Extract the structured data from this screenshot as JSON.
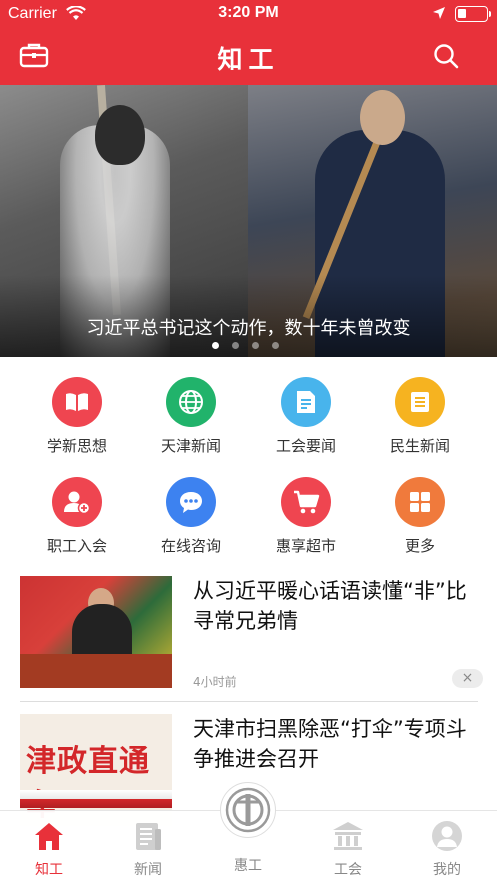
{
  "status_bar": {
    "carrier": "Carrier",
    "time": "3:20 PM",
    "battery": 0.2
  },
  "nav": {
    "title": "知工",
    "left_icon": "briefcase-icon",
    "right_icon": "search-icon"
  },
  "banner": {
    "caption": "习近平总书记这个动作，数十年未曾改变",
    "page_count": 4,
    "active_page": 1
  },
  "menu": {
    "items": [
      {
        "label": "学新思想",
        "icon": "book-icon",
        "color": "#ef4550"
      },
      {
        "label": "天津新闻",
        "icon": "globe-icon",
        "color": "#21b36b"
      },
      {
        "label": "工会要闻",
        "icon": "document-icon",
        "color": "#48b4ec"
      },
      {
        "label": "民生新闻",
        "icon": "list-icon",
        "color": "#f6b320"
      },
      {
        "label": "职工入会",
        "icon": "user-add-icon",
        "color": "#ef4550"
      },
      {
        "label": "在线咨询",
        "icon": "chat-icon",
        "color": "#3d82f0"
      },
      {
        "label": "惠享超市",
        "icon": "cart-icon",
        "color": "#ef4550"
      },
      {
        "label": "更多",
        "icon": "grid-icon",
        "color": "#f07a3c"
      }
    ]
  },
  "news": [
    {
      "title": "从习近平暖心话语读懂“非”比寻常兄弟情",
      "time": "4小时前",
      "close": "×"
    },
    {
      "title": "天津市扫黑除恶“打伞”专项斗争推进会召开",
      "thumb_text": "津政直通车"
    }
  ],
  "tabbar": {
    "active_color": "#e8313a",
    "tabs": [
      {
        "label": "知工",
        "icon": "home-icon",
        "active": true
      },
      {
        "label": "新闻",
        "icon": "news-icon",
        "active": false
      },
      {
        "label": "惠工",
        "icon": "union-logo-icon",
        "active": false
      },
      {
        "label": "工会",
        "icon": "building-icon",
        "active": false
      },
      {
        "label": "我的",
        "icon": "profile-icon",
        "active": false
      }
    ]
  }
}
